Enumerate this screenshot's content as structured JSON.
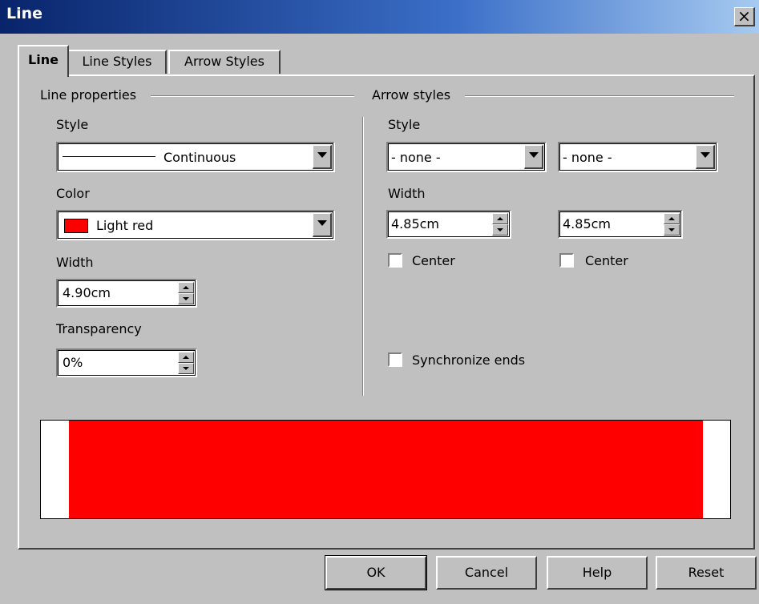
{
  "window": {
    "title": "Line",
    "close_glyph": "×"
  },
  "tabs": [
    {
      "label": "Line",
      "active": true
    },
    {
      "label": "Line Styles",
      "active": false
    },
    {
      "label": "Arrow Styles",
      "active": false
    }
  ],
  "line_properties": {
    "group_label": "Line properties",
    "style": {
      "label": "Style",
      "value": "Continuous"
    },
    "color": {
      "label": "Color",
      "value": "Light red",
      "swatch": "#ff0000"
    },
    "width": {
      "label": "Width",
      "value": "4.90cm"
    },
    "transparency": {
      "label": "Transparency",
      "value": "0%"
    }
  },
  "arrow_styles": {
    "group_label": "Arrow styles",
    "style_label": "Style",
    "start_style": "- none -",
    "end_style": "- none -",
    "width_label": "Width",
    "start_width": "4.85cm",
    "end_width": "4.85cm",
    "start_center": {
      "label": "Center",
      "checked": false
    },
    "end_center": {
      "label": "Center",
      "checked": false
    },
    "synchronize": {
      "label": "Synchronize ends",
      "checked": false
    }
  },
  "preview": {
    "line_color": "#ff0000"
  },
  "buttons": {
    "ok": "OK",
    "cancel": "Cancel",
    "help": "Help",
    "reset": "Reset"
  }
}
